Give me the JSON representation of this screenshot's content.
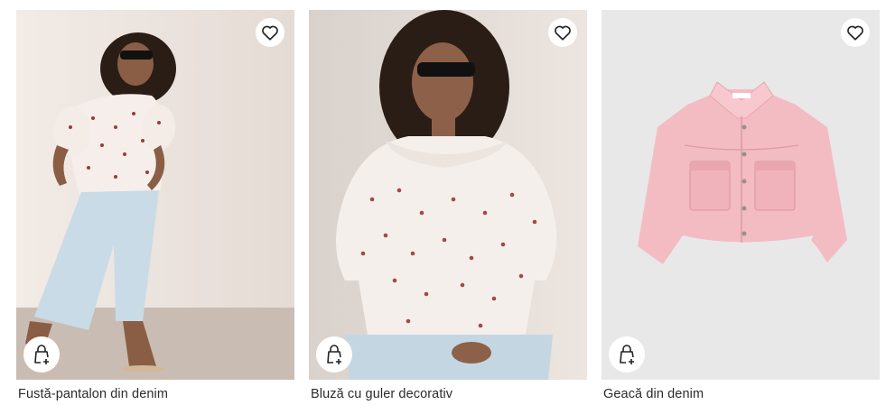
{
  "products": [
    {
      "name": "Fustă-pantalon din denim",
      "favorite_icon": "heart-outline-icon",
      "add_icon": "bag-plus-icon"
    },
    {
      "name": "Bluză cu guler decorativ",
      "favorite_icon": "heart-outline-icon",
      "add_icon": "bag-plus-icon"
    },
    {
      "name": "Geacă din denim",
      "favorite_icon": "heart-outline-icon",
      "add_icon": "bag-plus-icon"
    }
  ],
  "colors": {
    "text": "#2b2b2b",
    "card_bg_1": "#ece4de",
    "card_bg_2": "#e6dfda",
    "card_bg_3": "#e9e9e9",
    "jacket": "#f2b9c0"
  }
}
